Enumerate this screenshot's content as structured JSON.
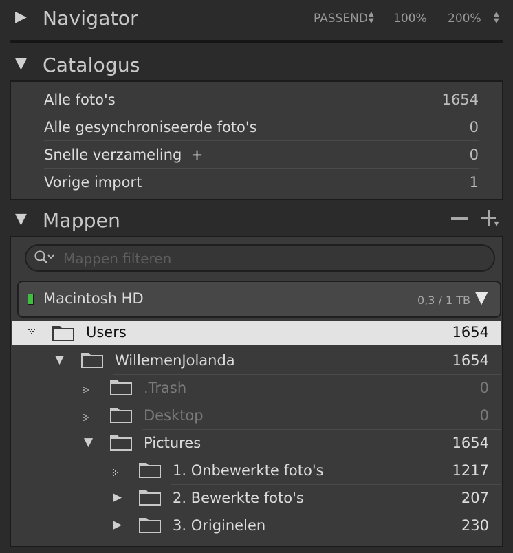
{
  "navigator": {
    "title": "Navigator",
    "fit": "PASSEND",
    "zoom1": "100%",
    "zoom2": "200%"
  },
  "catalogus": {
    "title": "Catalogus",
    "items": [
      {
        "label": "Alle foto's",
        "count": "1654"
      },
      {
        "label": "Alle gesynchroniseerde foto's",
        "count": "0"
      },
      {
        "label": "Snelle verzameling  +",
        "count": "0"
      },
      {
        "label": "Vorige import",
        "count": "1"
      }
    ]
  },
  "mappen": {
    "title": "Mappen",
    "filter_placeholder": "Mappen filteren",
    "volume": {
      "name": "Macintosh HD",
      "usage": "0,3 / 1 TB"
    },
    "folders": [
      {
        "name": "Users",
        "count": "1654",
        "selected": true,
        "dim": false
      },
      {
        "name": "WillemenJolanda",
        "count": "1654",
        "selected": false,
        "dim": false
      },
      {
        "name": ".Trash",
        "count": "0",
        "selected": false,
        "dim": true
      },
      {
        "name": "Desktop",
        "count": "0",
        "selected": false,
        "dim": true
      },
      {
        "name": "Pictures",
        "count": "1654",
        "selected": false,
        "dim": false
      },
      {
        "name": "1. Onbewerkte foto's",
        "count": "1217",
        "selected": false,
        "dim": false
      },
      {
        "name": "2. Bewerkte foto's",
        "count": "207",
        "selected": false,
        "dim": false
      },
      {
        "name": "3. Originelen",
        "count": "230",
        "selected": false,
        "dim": false
      }
    ]
  },
  "colors": {
    "background": "#2b2b2b",
    "panel": "#3a3a3a",
    "selected_row": "#e3e3e3",
    "volume_indicator": "#3fbf3f"
  }
}
